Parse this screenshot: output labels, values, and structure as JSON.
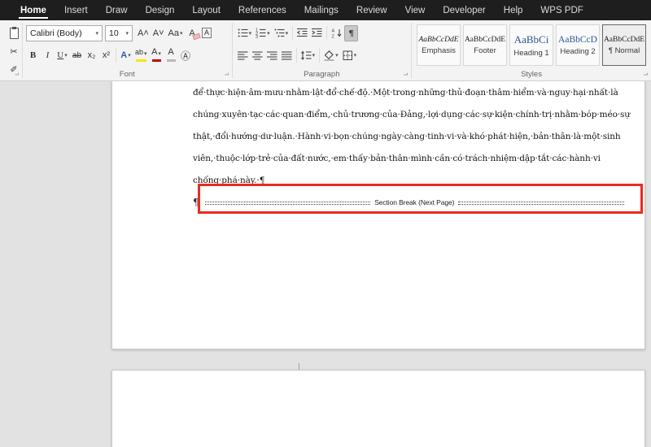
{
  "colors": {
    "annotation": "#ea2b20",
    "heading": "#2f5496",
    "menubar_bg": "#1e1e1e",
    "ribbon_bg": "#f3f3f3"
  },
  "menu": {
    "tabs": [
      {
        "label": "Home",
        "active": true
      },
      {
        "label": "Insert"
      },
      {
        "label": "Draw"
      },
      {
        "label": "Design"
      },
      {
        "label": "Layout"
      },
      {
        "label": "References"
      },
      {
        "label": "Mailings"
      },
      {
        "label": "Review"
      },
      {
        "label": "View"
      },
      {
        "label": "Developer"
      },
      {
        "label": "Help"
      },
      {
        "label": "WPS PDF"
      }
    ]
  },
  "ribbon": {
    "font_group": {
      "label": "Font",
      "font_name": "Calibri (Body)",
      "font_size": "10"
    },
    "paragraph_group": {
      "label": "Paragraph"
    },
    "styles_group": {
      "label": "Styles",
      "styles": [
        {
          "sample": "AaBbCcDdE",
          "name": "Emphasis",
          "selected": false
        },
        {
          "sample": "AaBbCcDdE",
          "name": "Footer",
          "selected": false
        },
        {
          "sample": "AaBbCi",
          "name": "Heading 1",
          "selected": false
        },
        {
          "sample": "AaBbCcD",
          "name": "Heading 2",
          "selected": false
        },
        {
          "sample": "AaBbCcDdE",
          "name": "¶ Normal",
          "selected": true
        }
      ]
    }
  },
  "icons": {
    "cut": "✂",
    "copy": "⧉",
    "format_painter": "✐",
    "grow_font": "A˄",
    "shrink_font": "A˅",
    "change_case": "Aa",
    "clear_formatting": "A",
    "character_border": "A",
    "bold": "B",
    "italic": "I",
    "underline": "U",
    "strikethrough": "ab",
    "subscript": "x₂",
    "superscript": "x²",
    "text_effects": "A",
    "highlight": "ab",
    "font_color": "A",
    "character_shading": "A",
    "enclose_characters": "Ⓐ",
    "pilcrow": "¶",
    "dialog_launcher": "⌐",
    "caret": "▾"
  },
  "document": {
    "lines": [
      "để·thực·hiện·âm·mưu·nhằm·lật·đổ·chế·độ.·Một·trong·những·thủ·đoạn·thâm·hiểm·và·nguy·hại·nhất·là",
      "chúng·xuyên·tạc·các·quan·điểm,·chủ·trương·của·Đảng,·lợi·dụng·các·sự·kiện·chính·trị·nhằm·bóp·méo·sự",
      "thật,·đổi·hướng·dư·luận.·Hành·vi·bọn·chúng·ngày·càng·tinh·vi·và·khó·phát·hiện,·bản·thân·là·một·sinh",
      "viên,·thuộc·lớp·trẻ·của·đất·nước,·em·thấy·bản·thân·mình·cần·có·trách·nhiệm·dập·tắt·các·hành·vi",
      "chống·phá·này.·¶"
    ],
    "section_break": {
      "pilcrow": "¶",
      "label": "Section Break (Next Page)"
    }
  }
}
